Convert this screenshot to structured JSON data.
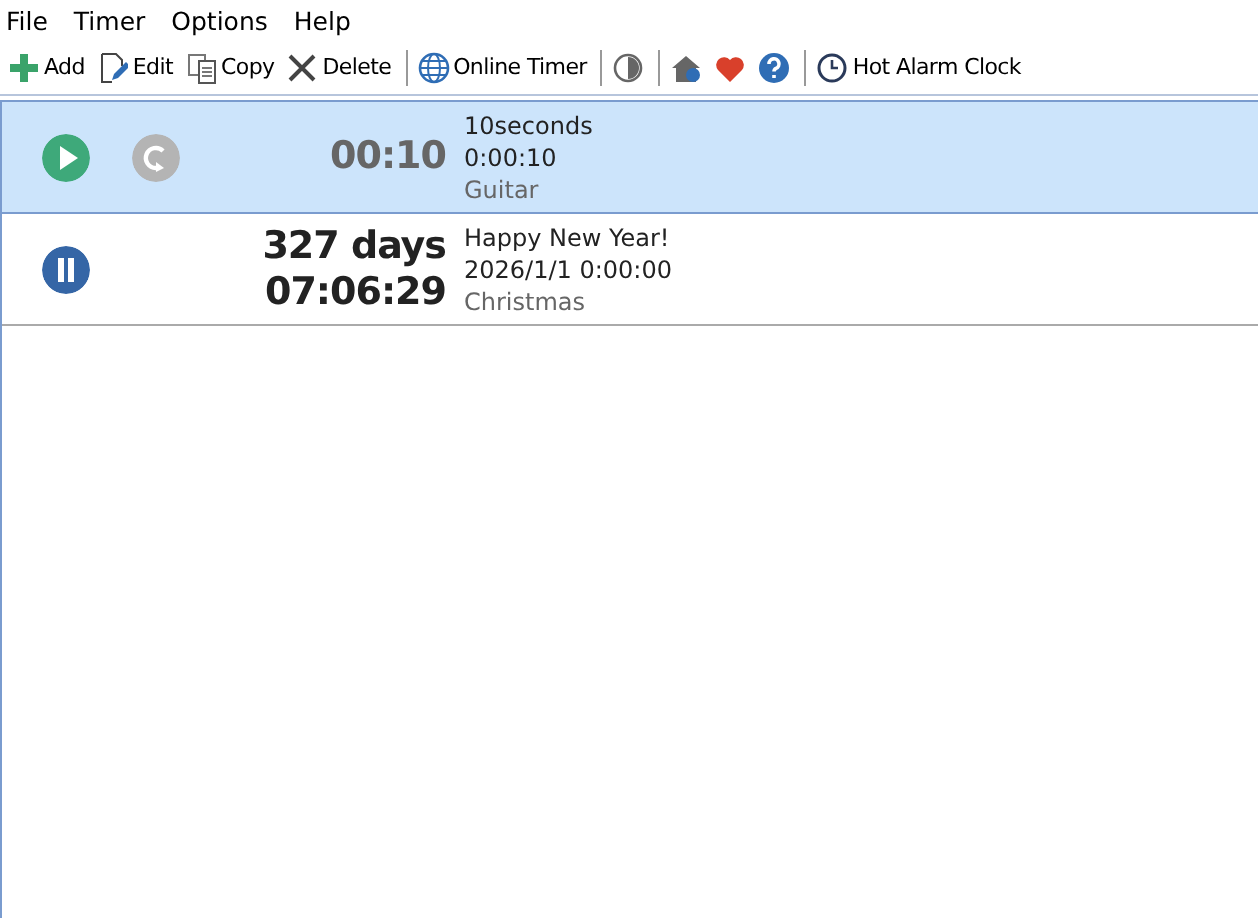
{
  "menu": [
    "File",
    "Timer",
    "Options",
    "Help"
  ],
  "toolbar": [
    {
      "kind": "button",
      "label": "Add"
    },
    {
      "kind": "button",
      "label": "Edit"
    },
    {
      "kind": "button",
      "label": "Copy"
    },
    {
      "kind": "button",
      "label": "Delete"
    },
    {
      "kind": "separator"
    },
    {
      "kind": "button",
      "label": "Online Timer"
    },
    {
      "kind": "separator"
    },
    {
      "kind": "button"
    },
    {
      "kind": "separator"
    },
    {
      "kind": "button"
    },
    {
      "kind": "button"
    },
    {
      "kind": "button"
    },
    {
      "kind": "separator"
    },
    {
      "kind": "button",
      "label": "Hot Alarm Clock"
    }
  ],
  "timers": [
    {
      "selected": true,
      "running": false,
      "time_lines": [
        "00:10"
      ],
      "name": "10seconds",
      "target": "0:00:10",
      "sound": "Guitar"
    },
    {
      "selected": false,
      "running": true,
      "time_lines": [
        "327 days",
        "07:06:29"
      ],
      "name": "Happy New Year!",
      "target": "2026/1/1 0:00:00",
      "sound": "Christmas"
    }
  ]
}
